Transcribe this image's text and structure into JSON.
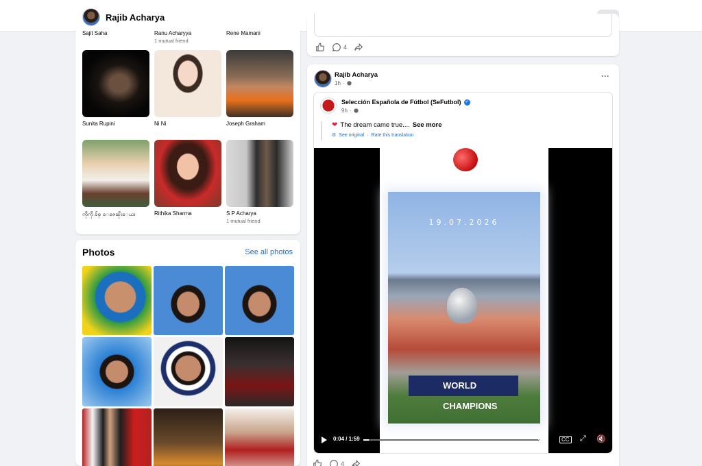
{
  "topbar": {
    "profile_name": "Rajib Acharya",
    "more_label": "···"
  },
  "friends": {
    "top_row": [
      {
        "name": "Sajit Saha",
        "mutual": ""
      },
      {
        "name": "Ranu Acharyya",
        "mutual": "1 mutual friend"
      },
      {
        "name": "Rene Mamani",
        "mutual": ""
      }
    ],
    "items": [
      {
        "name": "Sunita Rupini",
        "mutual": ""
      },
      {
        "name": "Ni Ni",
        "mutual": ""
      },
      {
        "name": "Joseph Graham",
        "mutual": ""
      },
      {
        "name": "ကိုကို ခ်စ္ ေဇေဆိုးေယး",
        "mutual": ""
      },
      {
        "name": "Rithika Sharma",
        "mutual": ""
      },
      {
        "name": "S P Acharya",
        "mutual": "1 mutual friend"
      }
    ]
  },
  "photos": {
    "title": "Photos",
    "see_all": "See all photos"
  },
  "previous_post": {
    "comment_count": "4"
  },
  "post": {
    "author": "Rajib Acharya",
    "time": "1h",
    "more": "···",
    "shared": {
      "page_name": "Selección Española de Fútbol (SeFutbol)",
      "time": "9h",
      "caption": "The dream came true....",
      "see_more": "See more",
      "see_original": "See original",
      "separator": "·",
      "rate_translation": "Rate this translation"
    },
    "video": {
      "date_overlay": "19.07.2026",
      "banner_text": "WORLD CHAMPIONS",
      "time": "0:04 / 1:59",
      "progress": 0.03
    },
    "comment_count": "4"
  },
  "colors": {
    "link": "#216fdb",
    "brand_blue": "#1877f2",
    "background": "#f0f2f5"
  }
}
